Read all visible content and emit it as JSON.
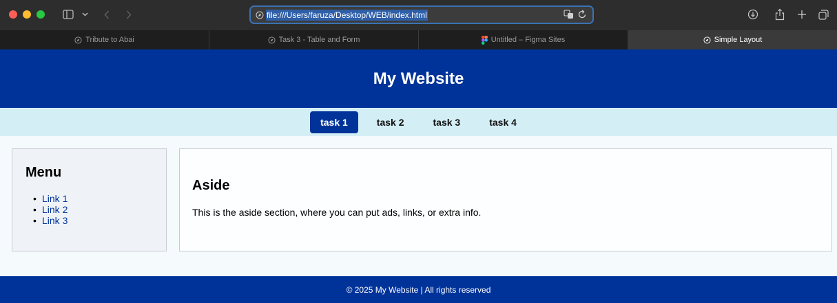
{
  "browser": {
    "url": "file:///Users/faruza/Desktop/WEB/index.html",
    "tabs": [
      {
        "label": "Tribute to Abai",
        "icon": "compass-icon",
        "active": false
      },
      {
        "label": "Task 3 - Table and Form",
        "icon": "compass-icon",
        "active": false
      },
      {
        "label": "Untitled – Figma Sites",
        "icon": "figma-icon",
        "active": false
      },
      {
        "label": "Simple Layout",
        "icon": "compass-icon",
        "active": true
      }
    ]
  },
  "header": {
    "title": "My Website"
  },
  "nav": {
    "items": [
      {
        "label": "task 1",
        "active": true
      },
      {
        "label": "task 2",
        "active": false
      },
      {
        "label": "task 3",
        "active": false
      },
      {
        "label": "task 4",
        "active": false
      }
    ]
  },
  "menu": {
    "title": "Menu",
    "links": [
      "Link 1",
      "Link 2",
      "Link 3"
    ]
  },
  "aside": {
    "title": "Aside",
    "text": "This is the aside section, where you can put ads, links, or extra info."
  },
  "footer": {
    "text": "© 2025 My Website | All rights reserved"
  },
  "colors": {
    "primary": "#003399",
    "nav_bg": "#d4eef5",
    "link": "#003399"
  }
}
